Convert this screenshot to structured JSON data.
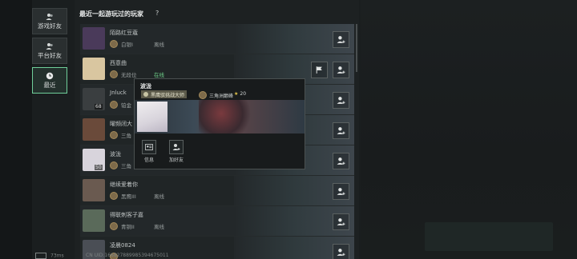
{
  "sidebar": {
    "items": [
      {
        "label": "游戏好友",
        "active": false
      },
      {
        "label": "平台好友",
        "active": false
      },
      {
        "label": "最近",
        "active": true
      }
    ]
  },
  "header": {
    "title": "最近一起游玩过的玩家",
    "help": "?"
  },
  "players": [
    {
      "name": "陌路红豆蔻",
      "rank": "白银I",
      "status": "离线",
      "level": "",
      "avatar_color": "#4a3a5a"
    },
    {
      "name": "西意曲",
      "rank": "无段位",
      "status": "在线",
      "level": "",
      "avatar_color": "#d9c6a0"
    },
    {
      "name": "Jnluck",
      "rank": "铂金",
      "status": "",
      "level": "68",
      "avatar_color": "#3a3e40"
    },
    {
      "name": "曜频闭大",
      "rank": "三角",
      "status": "",
      "level": "",
      "avatar_color": "#6a4a3a"
    },
    {
      "name": "波泷",
      "rank": "三角",
      "status": "",
      "level": "50",
      "avatar_color": "#d8d4dc"
    },
    {
      "name": "继续爱着你",
      "rank": "黑鹰III",
      "status": "离线",
      "level": "",
      "avatar_color": "#6a5a50"
    },
    {
      "name": "得联刺客子嘉",
      "rank": "青铜II",
      "status": "离线",
      "level": "",
      "avatar_color": "#5a6a5a"
    },
    {
      "name": "凌晨0824",
      "rank": "",
      "status": "",
      "level": "",
      "avatar_color": "#4a4e55"
    }
  ],
  "popup": {
    "name": "波泷",
    "tag": "黑鹰驭挑战大师",
    "rank": "三角洲巅峰",
    "stars": "20",
    "actions": [
      {
        "label": "信息"
      },
      {
        "label": "加好友"
      }
    ]
  },
  "footer": {
    "ping": "73ms",
    "uid": "CN UID:166827889985394675011"
  }
}
